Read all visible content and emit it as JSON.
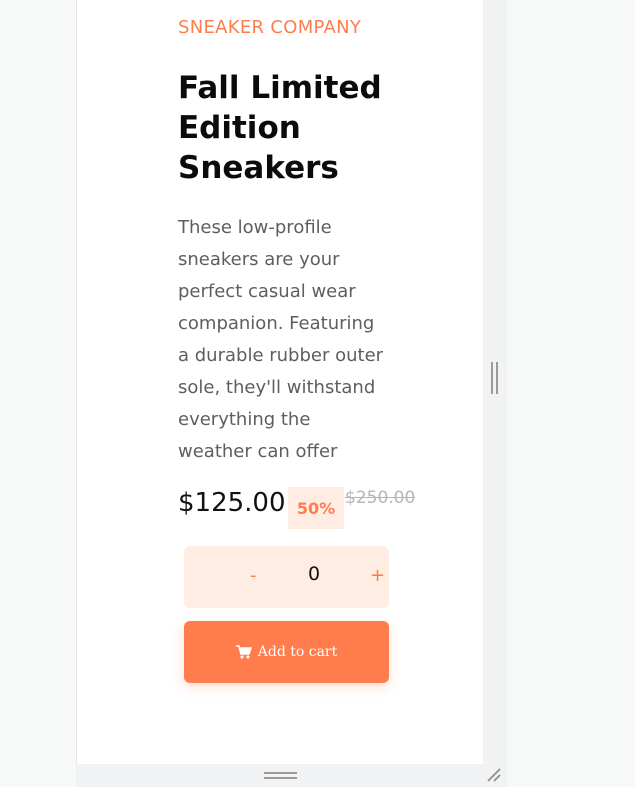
{
  "product": {
    "brand": "SNEAKER COMPANY",
    "title": "Fall Limited Edition Sneakers",
    "description": "These low-profile sneakers are your perfect casual wear companion. Featuring a durable rubber outer sole, they'll withstand everything the weather can offer",
    "price": "$125.00",
    "discount": "50%",
    "old_price": "$250.00"
  },
  "quantity": {
    "minus_label": "-",
    "value": "0",
    "plus_label": "+"
  },
  "cart": {
    "add_label": "Add to cart",
    "icon": "cart-icon"
  },
  "colors": {
    "accent": "#ff7d4d",
    "accent_pale": "#ffede4",
    "text_dark": "#0b0b0b",
    "text_body": "#5e5e5e",
    "text_muted": "#b6b6b6"
  }
}
